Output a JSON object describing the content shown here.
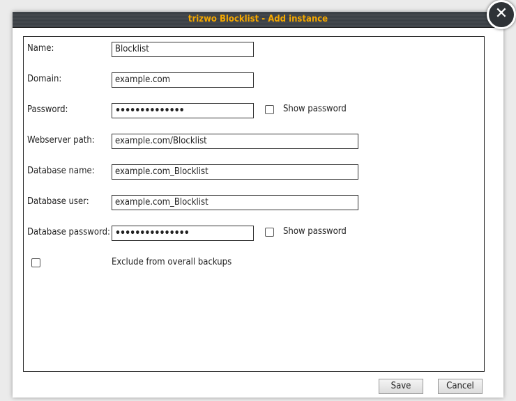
{
  "dialog": {
    "title": "trizwo Blocklist - Add instance",
    "close_glyph": "✕",
    "icons": {
      "close": "close-icon"
    }
  },
  "form": {
    "name": {
      "label": "Name:",
      "value": "Blocklist"
    },
    "domain": {
      "label": "Domain:",
      "value": "example.com"
    },
    "password": {
      "label": "Password:",
      "value": "••••••••••••••",
      "show_label": "Show password",
      "show_checked": false
    },
    "webserver_path": {
      "label": "Webserver path:",
      "value": "example.com/Blocklist"
    },
    "database_name": {
      "label": "Database name:",
      "value": "example.com_Blocklist"
    },
    "database_user": {
      "label": "Database user:",
      "value": "example.com_Blocklist"
    },
    "database_password": {
      "label": "Database password:",
      "value": "•••••••••••••••",
      "show_label": "Show password",
      "show_checked": false
    },
    "exclude_backups": {
      "label": "Exclude from overall backups",
      "checked": false
    }
  },
  "buttons": {
    "save": "Save",
    "cancel": "Cancel"
  },
  "colors": {
    "title_text": "#f5a800",
    "titlebar_bg": "#3a3f44"
  }
}
